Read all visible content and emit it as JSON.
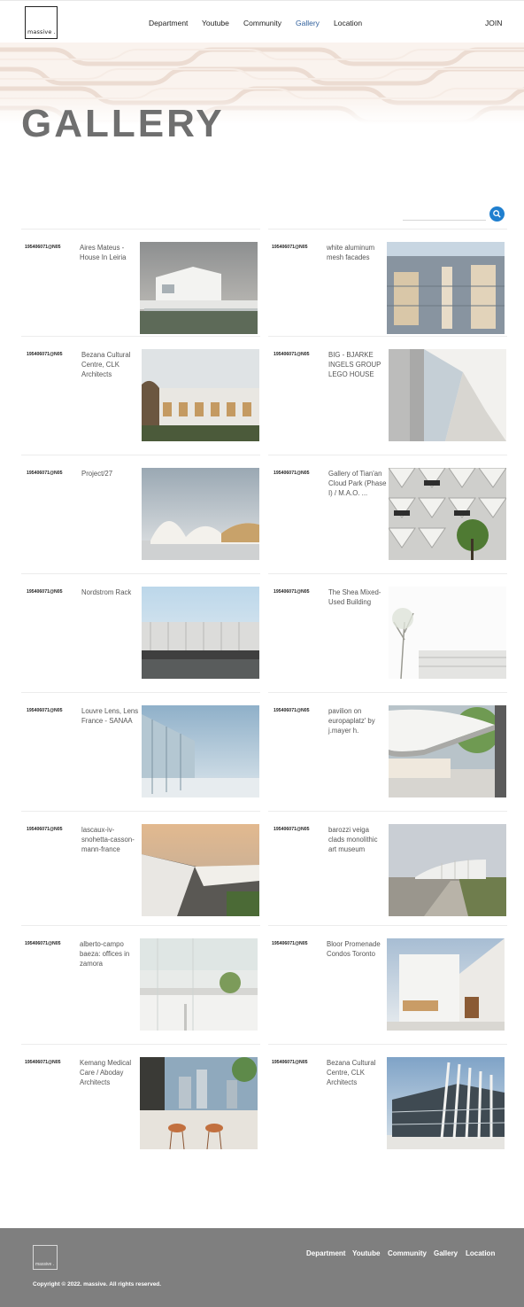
{
  "brand": {
    "logo_text": "massive ."
  },
  "nav": {
    "items": [
      "Department",
      "Youtube",
      "Community",
      "Gallery",
      "Location"
    ],
    "active": "Gallery",
    "join_label": "JOIN"
  },
  "page": {
    "title": "GALLERY"
  },
  "search": {
    "value": "",
    "placeholder": ""
  },
  "gallery": {
    "items": [
      {
        "author": "195406071@N05",
        "title": "Aires Mateus - House In Leiria"
      },
      {
        "author": "195406071@N05",
        "title": "white aluminum mesh facades"
      },
      {
        "author": "195406071@N05",
        "title": "Bezana Cultural Centre, CLK Architects"
      },
      {
        "author": "195406071@N05",
        "title": "BIG - BJARKE INGELS GROUP LEGO HOUSE"
      },
      {
        "author": "195406071@N05",
        "title": "Project/27"
      },
      {
        "author": "195406071@N05",
        "title": "Gallery of Tian'an Cloud Park (Phase I) / M.A.O. ..."
      },
      {
        "author": "195406071@N05",
        "title": "Nordstrom Rack"
      },
      {
        "author": "195406071@N05",
        "title": "The Shea Mixed-Used Building"
      },
      {
        "author": "195406071@N05",
        "title": "Louvre Lens, Lens France - SANAA"
      },
      {
        "author": "195406071@N05",
        "title": "pavilion on europaplatz' by j.mayer h."
      },
      {
        "author": "195406071@N05",
        "title": "lascaux-iv-snohetta-casson-mann-france"
      },
      {
        "author": "195406071@N05",
        "title": "barozzi veiga clads monolithic art museum"
      },
      {
        "author": "195406071@N05",
        "title": "alberto-campo baeza: offices in zamora"
      },
      {
        "author": "195406071@N05",
        "title": "Bloor Promenade Condos Toronto"
      },
      {
        "author": "195406071@N05",
        "title": "Kemang Medical Care / Aboday Architects"
      },
      {
        "author": "195406071@N05",
        "title": "Bezana Cultural Centre, CLK Architects"
      }
    ]
  },
  "footer": {
    "logo_text": "massive .",
    "nav": [
      "Department",
      "Youtube",
      "Community",
      "Gallery",
      "Location"
    ],
    "copyright": "Copyright © 2022. massive. All rights reserved."
  },
  "colors": {
    "accent": "#1f7fcf",
    "active_nav": "#2f5f9c",
    "footer_bg": "#7f7f7f",
    "title_gray": "#6f6f6f"
  }
}
